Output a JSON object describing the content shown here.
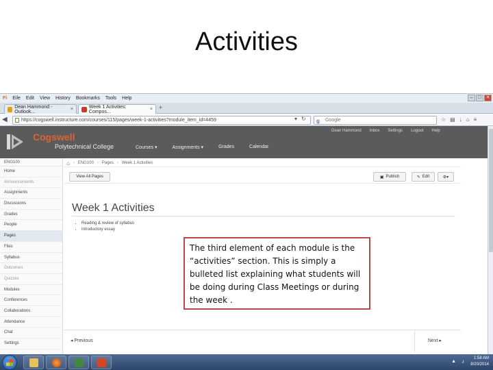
{
  "slide": {
    "title": "Activities"
  },
  "browser": {
    "menu": [
      "Eile",
      "Edit",
      "View",
      "History",
      "Bookmarks",
      "Tools",
      "Help"
    ],
    "menu_logo": "Fi",
    "tabs": [
      {
        "label": "Dean Hammond - Outlook...",
        "icon_color": "#e2a400"
      },
      {
        "label": "Week 1 Activities: Compos...",
        "icon_color": "#c83b2a"
      }
    ],
    "new_tab": "+",
    "url": "https://cogswell.instructure.com/courses/115/pages/week-1-activities?module_item_id=4459",
    "search_placeholder": "Google",
    "search_logo": "g"
  },
  "canvas": {
    "brand_name": "Cogswell",
    "brand_sub": "Polytechnical College",
    "global_nav": [
      "Courses ▾",
      "Assignments ▾",
      "Grades",
      "Calendar"
    ],
    "user_nav": [
      "Dean Hammond",
      "Inbox",
      "Settings",
      "Logout",
      "Help"
    ],
    "course_code": "ENG100",
    "sidebar": [
      {
        "label": "Home",
        "state": "normal"
      },
      {
        "label": "Announcements",
        "state": "muted"
      },
      {
        "label": "Assignments",
        "state": "normal"
      },
      {
        "label": "Discussions",
        "state": "normal"
      },
      {
        "label": "Grades",
        "state": "normal"
      },
      {
        "label": "People",
        "state": "normal"
      },
      {
        "label": "Pages",
        "state": "active"
      },
      {
        "label": "Files",
        "state": "normal"
      },
      {
        "label": "Syllabus",
        "state": "normal"
      },
      {
        "label": "Outcomes",
        "state": "muted"
      },
      {
        "label": "Quizzes",
        "state": "muted"
      },
      {
        "label": "Modules",
        "state": "normal"
      },
      {
        "label": "Conferences",
        "state": "normal"
      },
      {
        "label": "Collaborations",
        "state": "normal"
      },
      {
        "label": "Attendance",
        "state": "normal"
      },
      {
        "label": "Chat",
        "state": "normal"
      },
      {
        "label": "Settings",
        "state": "normal"
      }
    ],
    "breadcrumb": [
      "ENG100",
      "Pages",
      "Week 1 Activities"
    ],
    "view_all_pages": "View All Pages",
    "publish": "Publish",
    "edit": "Edit",
    "gear": "⚙▾",
    "page_title": "Week 1 Activities",
    "bullets": [
      "Reading & review of syllabus",
      "Introductory essay"
    ],
    "previous": "◂ Previous",
    "next": "Next ▸"
  },
  "callout": {
    "text": "The third element of each module is the “activities” section. This is simply a bulleted list explaining what students will be doing during Class Meetings or during the week ."
  },
  "taskbar": {
    "time": "1:58 AM",
    "date": "8/20/2014"
  }
}
